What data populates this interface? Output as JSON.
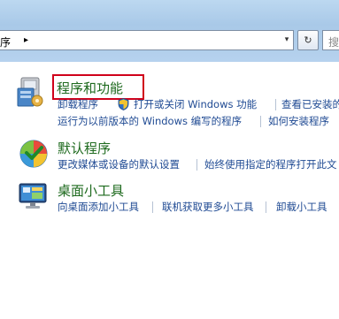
{
  "address_bar": {
    "breadcrumb": "序",
    "separator": "▸",
    "dropdown": "▾",
    "refresh": "↻",
    "search_placeholder": "搜"
  },
  "categories": [
    {
      "title": "程序和功能",
      "icon": "programs-features-icon",
      "links": [
        "卸载程序",
        "打开或关闭 Windows 功能",
        "查看已安装的",
        "运行为以前版本的 Windows 编写的程序",
        "如何安装程序"
      ]
    },
    {
      "title": "默认程序",
      "icon": "default-programs-icon",
      "links": [
        "更改媒体或设备的默认设置",
        "始终使用指定的程序打开此文"
      ]
    },
    {
      "title": "桌面小工具",
      "icon": "desktop-gadgets-icon",
      "links": [
        "向桌面添加小工具",
        "联机获取更多小工具",
        "卸载小工具"
      ]
    }
  ],
  "colors": {
    "title_green": "#1e6a1e",
    "link_blue": "#1f4a93",
    "highlight_red": "#d0021b"
  }
}
